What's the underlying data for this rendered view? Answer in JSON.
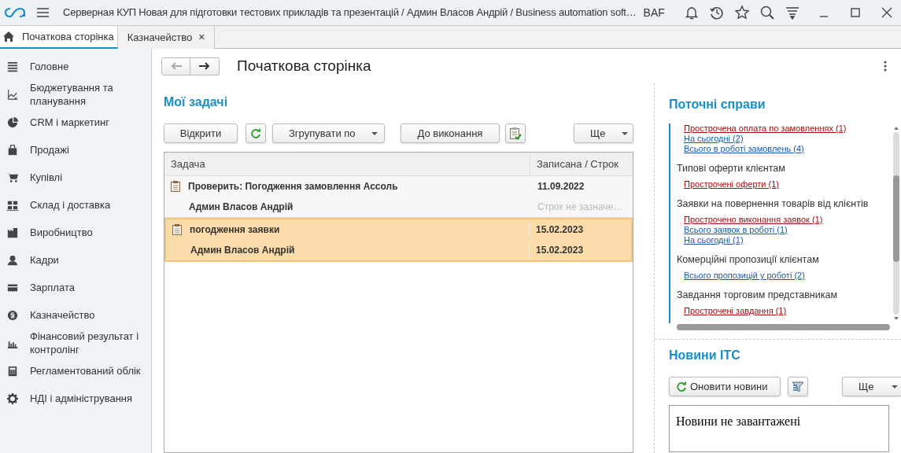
{
  "window": {
    "title": "Серверная КУП Новая для підготовки тестових прикладів та презентацій / Админ Власов Андрій / Business automation soft…",
    "brand": "BAF"
  },
  "tabs": [
    {
      "label": "Початкова сторінка",
      "selected": true
    },
    {
      "label": "Казначейство",
      "selected": false,
      "close": "×"
    }
  ],
  "sidebar": {
    "items": [
      {
        "label": "Головне"
      },
      {
        "label": "Бюджетування та планування"
      },
      {
        "label": "CRM і маркетинг"
      },
      {
        "label": "Продажі"
      },
      {
        "label": "Купівлі"
      },
      {
        "label": "Склад і доставка"
      },
      {
        "label": "Виробництво"
      },
      {
        "label": "Кадри"
      },
      {
        "label": "Зарплата"
      },
      {
        "label": "Казначейство"
      },
      {
        "label": "Фінансовий результат і контролінг"
      },
      {
        "label": "Регламентований облік"
      },
      {
        "label": "НДІ і адміністрування"
      }
    ]
  },
  "page_title": "Початкова сторінка",
  "tasks_panel": {
    "title": "Мої задачі",
    "buttons": {
      "open": "Відкрити",
      "group": "Згрупувати по",
      "todo": "До виконання",
      "more": "Ще"
    },
    "columns": [
      "Задача",
      "Записана / Строк"
    ],
    "rows": [
      {
        "title": "Проверить: Погодження замовлення Ассоль",
        "recorded": "11.09.2022",
        "author": "Админ Власов Андрій",
        "due": "Строк не зазначе…",
        "due_missing": true,
        "selected": false
      },
      {
        "title": "погодження заявки",
        "recorded": "15.02.2023",
        "author": "Админ Власов Андрій",
        "due": "15.02.2023",
        "due_missing": false,
        "selected": true
      }
    ]
  },
  "current_panel": {
    "title": "Поточні справи",
    "groups": [
      {
        "links": [
          {
            "label": "Прострочена оплата по замовленнях (1)",
            "overdue": true
          },
          {
            "label": "На сьогодні (2)",
            "overdue": false
          },
          {
            "label": "Всього в роботі замовлень (4)",
            "overdue": false
          }
        ]
      },
      {
        "heading": "Типові оферти клієнтам",
        "links": [
          {
            "label": "Прострочені оферти (1)",
            "overdue": true
          }
        ]
      },
      {
        "heading": "Заявки на повернення товарів від клієнтів",
        "links": [
          {
            "label": "Прострочено виконання заявок (1)",
            "overdue": true
          },
          {
            "label": "Всього заявок в роботі (1)",
            "overdue": false
          },
          {
            "label": "На сьогодні (1)",
            "overdue": false
          }
        ]
      },
      {
        "heading": "Комерційні пропозиції клієнтам",
        "links": [
          {
            "label": "Всього пропозицій у роботі (2)",
            "overdue": false
          }
        ]
      },
      {
        "heading": "Завдання торговим представникам",
        "links": [
          {
            "label": "Прострочені завдання (1)",
            "overdue": true
          }
        ]
      }
    ]
  },
  "news_panel": {
    "title": "Новини ІТС",
    "refresh": "Оновити новини",
    "more": "Ще",
    "message": "Новини не завантажені"
  }
}
